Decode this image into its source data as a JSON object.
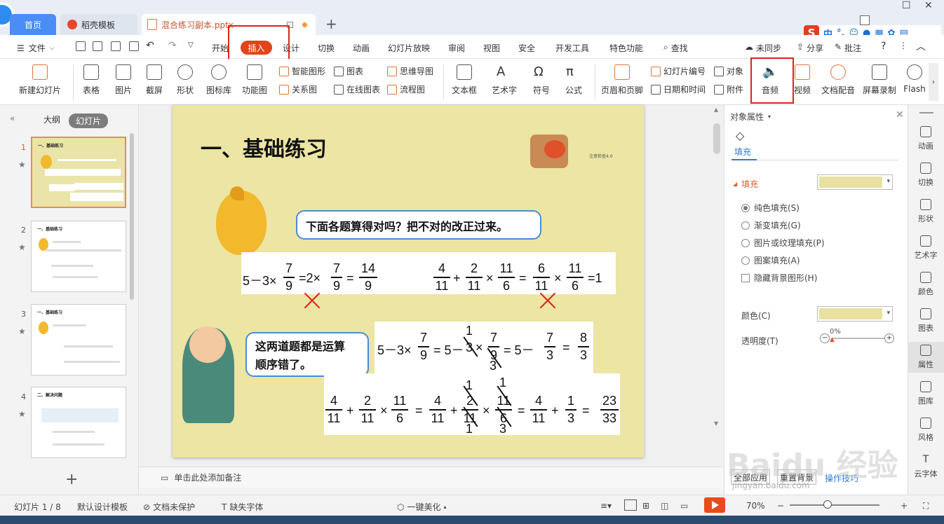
{
  "tabs": {
    "home": "首页",
    "templates": "稻壳模板",
    "document": "混合练习副本.pptx",
    "new_tab": "+"
  },
  "menubar": {
    "file": "文件",
    "items": [
      "开始",
      "插入",
      "设计",
      "切换",
      "动画",
      "幻灯片放映",
      "审阅",
      "视图",
      "安全",
      "开发工具",
      "特色功能"
    ],
    "search": "查找",
    "sync": "未同步",
    "share": "分享",
    "comment": "批注",
    "help": "?"
  },
  "ime": {
    "cn": "中",
    "sep": "°,"
  },
  "ribbon": {
    "new_slide": "新建幻灯片",
    "table": "表格",
    "picture": "图片",
    "screenshot": "截屏",
    "shape": "形状",
    "icon_lib": "图标库",
    "function_chart": "功能图",
    "smart_shape": "智能图形",
    "chart": "图表",
    "relation": "关系图",
    "online_chart": "在线图表",
    "mindmap": "思维导图",
    "flowchart": "流程图",
    "textbox": "文本框",
    "art_text": "艺术字",
    "symbol": "符号",
    "formula": "公式",
    "header_footer": "页眉和页脚",
    "slide_number": "幻灯片编号",
    "object": "对象",
    "datetime": "日期和时间",
    "attachment": "附件",
    "audio": "音频",
    "video": "视频",
    "doc_dub": "文档配音",
    "screen_record": "屏幕录制",
    "flash": "Flash"
  },
  "leftpanel": {
    "outline": "大纲",
    "slides": "幻灯片",
    "thumbs": [
      {
        "num": "1",
        "title": "一、基础练习"
      },
      {
        "num": "2",
        "title": "一、基础练习"
      },
      {
        "num": "3",
        "title": "一、基础练习"
      },
      {
        "num": "4",
        "title": "二、解决问题"
      }
    ],
    "add": "+"
  },
  "slide": {
    "title": "一、基础练习",
    "bubble1": "下面各题算得对吗？把不对的改正过来。",
    "bubble2_line1": "这两道题都是运算",
    "bubble2_line2": "顺序错了。",
    "eq1": {
      "a": "5－3×",
      "f1n": "7",
      "f1d": "9",
      "b": "=2×",
      "f2n": "7",
      "f2d": "9",
      "c": "=",
      "f3n": "14",
      "f3d": "9"
    },
    "eq2": {
      "f1n": "4",
      "f1d": "11",
      "p": "+",
      "f2n": "2",
      "f2d": "11",
      "x": "×",
      "f3n": "11",
      "f3d": "6",
      "e": "=",
      "f4n": "6",
      "f4d": "11",
      "x2": "×",
      "f5n": "11",
      "f5d": "6",
      "r": "=1"
    },
    "fix1": {
      "a": "5－3×",
      "f1n": "7",
      "f1d": "9",
      "b": "= 5－",
      "c1": "1",
      "d": "3",
      "x": "×",
      "f2n": "7",
      "f2d": "9",
      "c3": "3",
      "e": "= 5－",
      "f3n": "7",
      "f3d": "3",
      "g": "=",
      "f4n": "8",
      "f4d": "3"
    },
    "fix2": {
      "f1n": "4",
      "f1d": "11",
      "p": "+",
      "f2n": "2",
      "f2d": "11",
      "x": "×",
      "f3n": "11",
      "f3d": "6",
      "e1": "=",
      "f4n": "4",
      "f4d": "11",
      "p2": "+",
      "c1": "1",
      "f5n": "2",
      "f5d": "11",
      "c2": "1",
      "x2": "×",
      "c3": "1",
      "f6n": "11",
      "f6d": "6",
      "c4": "3",
      "e2": "=",
      "f7n": "4",
      "f7d": "11",
      "p3": "+",
      "f8n": "1",
      "f8d": "3",
      "e3": "=",
      "f9n": "23",
      "f9d": "33"
    },
    "deco_text": "注意检查4.0"
  },
  "notes": "单击此处添加备注",
  "rpanel": {
    "header": "对象属性",
    "tab_fill": "填充",
    "section_fill": "填充",
    "options": [
      "纯色填充(S)",
      "渐变填充(G)",
      "图片或纹理填充(P)",
      "图案填充(A)"
    ],
    "hide_bg": "隐藏背景图形(H)",
    "color_label": "颜色(C)",
    "transparency_label": "透明度(T)",
    "transparency_value": "0%",
    "apply_all": "全部应用",
    "reset_bg": "重置背景",
    "tips": "操作技巧",
    "fill_color": "#e8e1a0"
  },
  "rsidebar": [
    "动画",
    "切换",
    "形状",
    "艺术字",
    "颜色",
    "图表",
    "属性",
    "图库",
    "风格",
    "云字体"
  ],
  "status": {
    "slide_info": "幻灯片 1 / 8",
    "design_tpl": "默认设计模板",
    "doc_protect": "文档未保护",
    "missing_font": "缺失字体",
    "beautify": "一键美化",
    "zoom": "70%"
  },
  "watermark": {
    "big": "Baidu 经验",
    "small": "jingyan.baidu.com"
  },
  "colors": {
    "accent": "#e0451b",
    "highlight_box": "#e02020",
    "slide_bg": "#ece5a4"
  }
}
